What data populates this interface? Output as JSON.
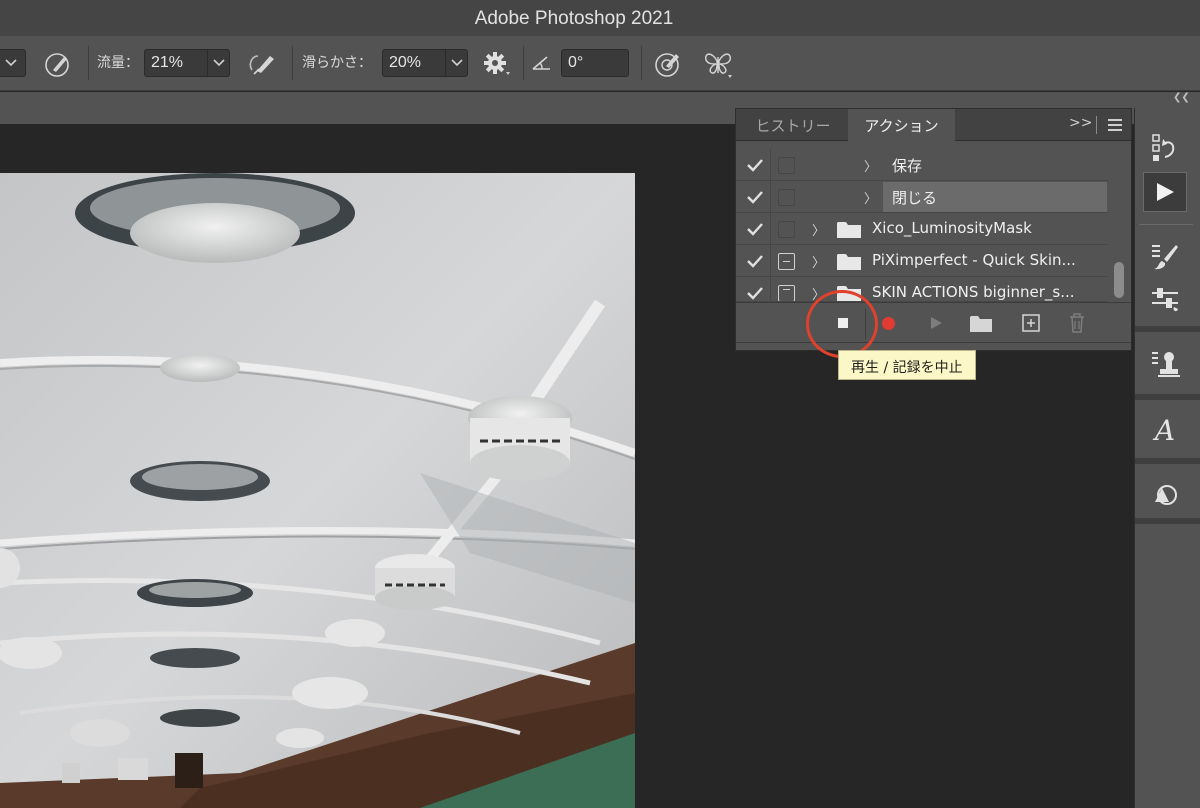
{
  "app": {
    "title": "Adobe Photoshop 2021"
  },
  "options_bar": {
    "flow_label": "流量：",
    "flow_value": "21%",
    "smoothing_label": "滑らかさ：",
    "smoothing_value": "20%",
    "angle_value": "0°"
  },
  "panel": {
    "tabs": [
      {
        "label": "ヒストリー",
        "active": false
      },
      {
        "label": "アクション",
        "active": true
      }
    ],
    "more_label": ">>",
    "rows": [
      {
        "label": "保存",
        "checked": true,
        "level": "step",
        "highlighted": false
      },
      {
        "label": "閉じる",
        "checked": true,
        "level": "step",
        "highlighted": true
      },
      {
        "label": "Xico_LuminosityMask",
        "checked": true,
        "level": "set",
        "dialog": "none"
      },
      {
        "label": "PiXimperfect - Quick Skin...",
        "checked": true,
        "level": "set",
        "dialog": "partial"
      },
      {
        "label": "SKIN ACTIONS biginner_s...",
        "checked": true,
        "level": "set",
        "dialog": "on"
      }
    ],
    "footer_buttons": [
      "stop-icon",
      "record-icon",
      "play-icon",
      "new-set-icon",
      "new-action-icon",
      "trash-icon"
    ]
  },
  "tooltip": {
    "text": "再生 / 記録を中止"
  },
  "colors": {
    "accent_red": "#e0412d",
    "record_red": "#e03c31",
    "tooltip_bg": "#fbf7c6"
  }
}
